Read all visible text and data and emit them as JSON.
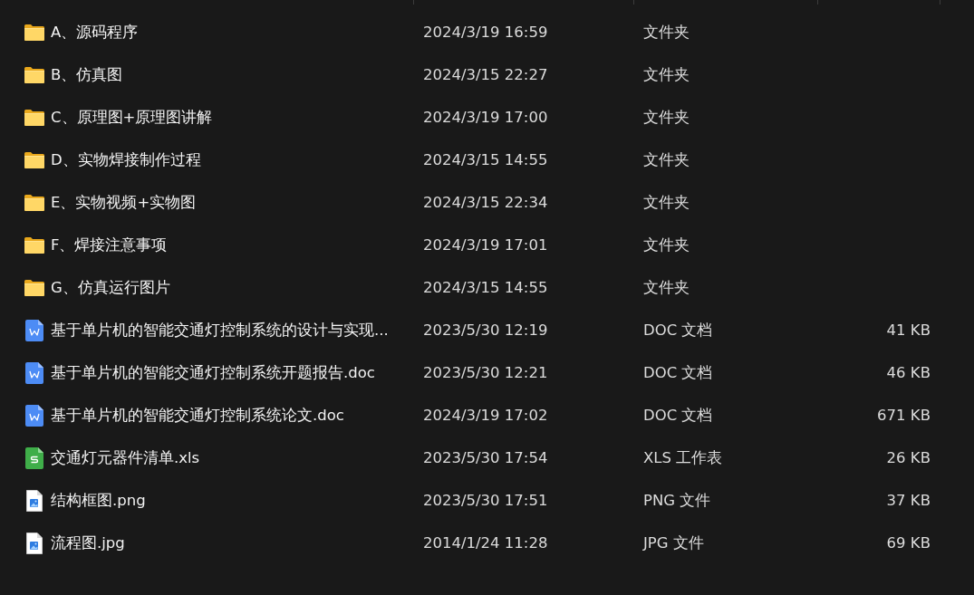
{
  "files": [
    {
      "kind": "folder",
      "name": "A、源码程序",
      "modified": "2024/3/19 16:59",
      "type": "文件夹"
    },
    {
      "kind": "folder",
      "name": "B、仿真图",
      "modified": "2024/3/15 22:27",
      "type": "文件夹"
    },
    {
      "kind": "folder",
      "name": "C、原理图+原理图讲解",
      "modified": "2024/3/19 17:00",
      "type": "文件夹"
    },
    {
      "kind": "folder",
      "name": "D、实物焊接制作过程",
      "modified": "2024/3/15 14:55",
      "type": "文件夹"
    },
    {
      "kind": "folder",
      "name": "E、实物视频+实物图",
      "modified": "2024/3/15 22:34",
      "type": "文件夹"
    },
    {
      "kind": "folder",
      "name": "F、焊接注意事项",
      "modified": "2024/3/19 17:01",
      "type": "文件夹"
    },
    {
      "kind": "folder",
      "name": "G、仿真运行图片",
      "modified": "2024/3/15 14:55",
      "type": "文件夹"
    },
    {
      "kind": "doc",
      "name": "基于单片机的智能交通灯控制系统的设计与实现...",
      "modified": "2023/5/30 12:19",
      "type": "DOC 文档",
      "size": "41 KB"
    },
    {
      "kind": "doc",
      "name": "基于单片机的智能交通灯控制系统开题报告.doc",
      "modified": "2023/5/30 12:21",
      "type": "DOC 文档",
      "size": "46 KB"
    },
    {
      "kind": "doc",
      "name": "基于单片机的智能交通灯控制系统论文.doc",
      "modified": "2024/3/19 17:02",
      "type": "DOC 文档",
      "size": "671 KB"
    },
    {
      "kind": "xls",
      "name": "交通灯元器件清单.xls",
      "modified": "2023/5/30 17:54",
      "type": "XLS 工作表",
      "size": "26 KB"
    },
    {
      "kind": "image",
      "name": "结构框图.png",
      "modified": "2023/5/30 17:51",
      "type": "PNG 文件",
      "size": "37 KB"
    },
    {
      "kind": "image",
      "name": "流程图.jpg",
      "modified": "2014/1/24 11:28",
      "type": "JPG 文件",
      "size": "69 KB"
    }
  ]
}
